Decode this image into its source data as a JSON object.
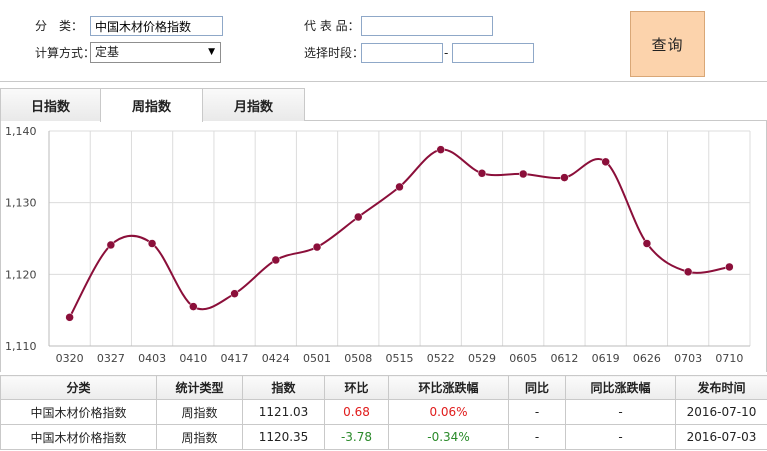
{
  "form": {
    "category_label": "分　类：",
    "category_value": "中国木材价格指数",
    "calc_label": "计算方式：",
    "calc_value": "定基",
    "product_label": "代 表 品：",
    "product_value": "",
    "period_label": "选择时段：",
    "period_start": "",
    "period_separator": "-",
    "period_end": "",
    "query_label": "查询"
  },
  "tabs": [
    {
      "label": "日指数",
      "active": false
    },
    {
      "label": "周指数",
      "active": true
    },
    {
      "label": "月指数",
      "active": false
    }
  ],
  "chart_data": {
    "type": "line",
    "categories": [
      "0320",
      "0327",
      "0403",
      "0410",
      "0417",
      "0424",
      "0501",
      "0508",
      "0515",
      "0522",
      "0529",
      "0605",
      "0612",
      "0619",
      "0626",
      "0703",
      "0710"
    ],
    "values": [
      1114.0,
      1124.1,
      1124.3,
      1115.5,
      1117.3,
      1122.0,
      1123.8,
      1128.0,
      1132.2,
      1137.4,
      1134.1,
      1134.0,
      1133.5,
      1135.7,
      1124.3,
      1120.35,
      1121.03
    ],
    "y_ticks": [
      "1,110",
      "1,120",
      "1,130",
      "1,140"
    ],
    "ylim": [
      1110,
      1140
    ],
    "grid": true,
    "colors": {
      "line": "#8b0f3a",
      "marker": "#8b0f3a",
      "grid": "#dcdcdc",
      "axis": "#bbbbbb"
    }
  },
  "table": {
    "headers": [
      "分类",
      "统计类型",
      "指数",
      "环比",
      "环比涨跌幅",
      "同比",
      "同比涨跌幅",
      "发布时间"
    ],
    "rows": [
      {
        "category": "中国木材价格指数",
        "type": "周指数",
        "index": "1121.03",
        "mom": "0.68",
        "mom_pct": "0.06%",
        "yoy": "-",
        "yoy_pct": "-",
        "date": "2016-07-10",
        "trend": "up"
      },
      {
        "category": "中国木材价格指数",
        "type": "周指数",
        "index": "1120.35",
        "mom": "-3.78",
        "mom_pct": "-0.34%",
        "yoy": "-",
        "yoy_pct": "-",
        "date": "2016-07-03",
        "trend": "down"
      }
    ]
  }
}
